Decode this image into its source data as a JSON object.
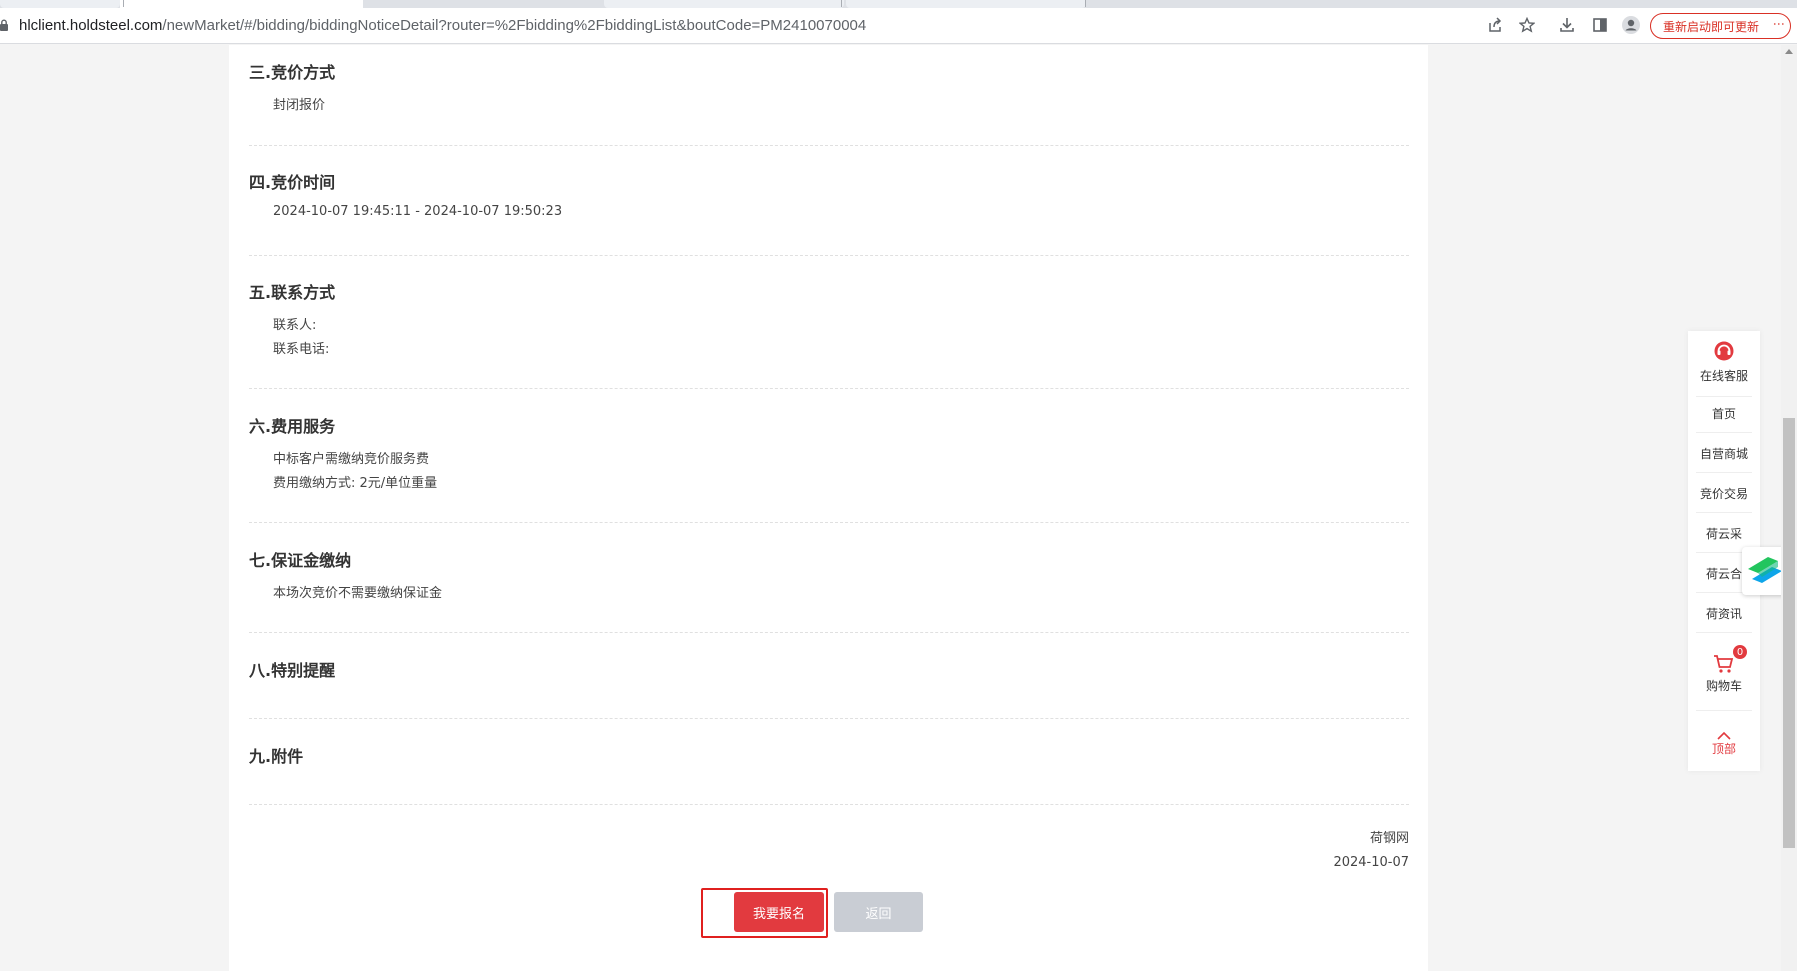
{
  "browser": {
    "url_host": "hlclient.holdsteel.com",
    "url_path": "/newMarket/#/bidding/biddingNoticeDetail?router=%2Fbidding%2FbiddingList&boutCode=PM2410070004",
    "update_label": "重新启动即可更新",
    "icons": [
      "lock-icon",
      "share-icon",
      "star-icon",
      "download-icon",
      "sidepanel-icon",
      "profile-icon",
      "more-icon"
    ]
  },
  "sections": [
    {
      "title": "三.竞价方式",
      "lines": [
        "封闭报价"
      ]
    },
    {
      "title": "四.竞价时间",
      "lines": [
        "2024-10-07 19:45:11 - 2024-10-07 19:50:23"
      ]
    },
    {
      "title": "五.联系方式",
      "lines": [
        "联系人:",
        "联系电话:"
      ]
    },
    {
      "title": "六.费用服务",
      "lines": [
        "中标客户需缴纳竞价服务费",
        "费用缴纳方式: 2元/单位重量"
      ]
    },
    {
      "title": "七.保证金缴纳",
      "lines": [
        "本场次竞价不需要缴纳保证金"
      ]
    },
    {
      "title": "八.特别提醒",
      "lines": []
    },
    {
      "title": "九.附件",
      "lines": []
    }
  ],
  "signature": {
    "org": "荷钢网",
    "date": "2024-10-07"
  },
  "actions": {
    "signup_label": "我要报名",
    "back_label": "返回"
  },
  "float_bar": {
    "service_label": "在线客服",
    "home_label": "首页",
    "mall_label": "自营商城",
    "bidding_label": "竞价交易",
    "cloud_purchase_label": "荷云采",
    "cloud_contract_label": "荷云合",
    "news_label": "荷资讯",
    "cart_label": "购物车",
    "cart_count": "0",
    "top_label": "顶部"
  },
  "colors": {
    "accent_red": "#e23a3f",
    "highlight_border": "#e0201f",
    "back_button": "#c9cdd4"
  }
}
